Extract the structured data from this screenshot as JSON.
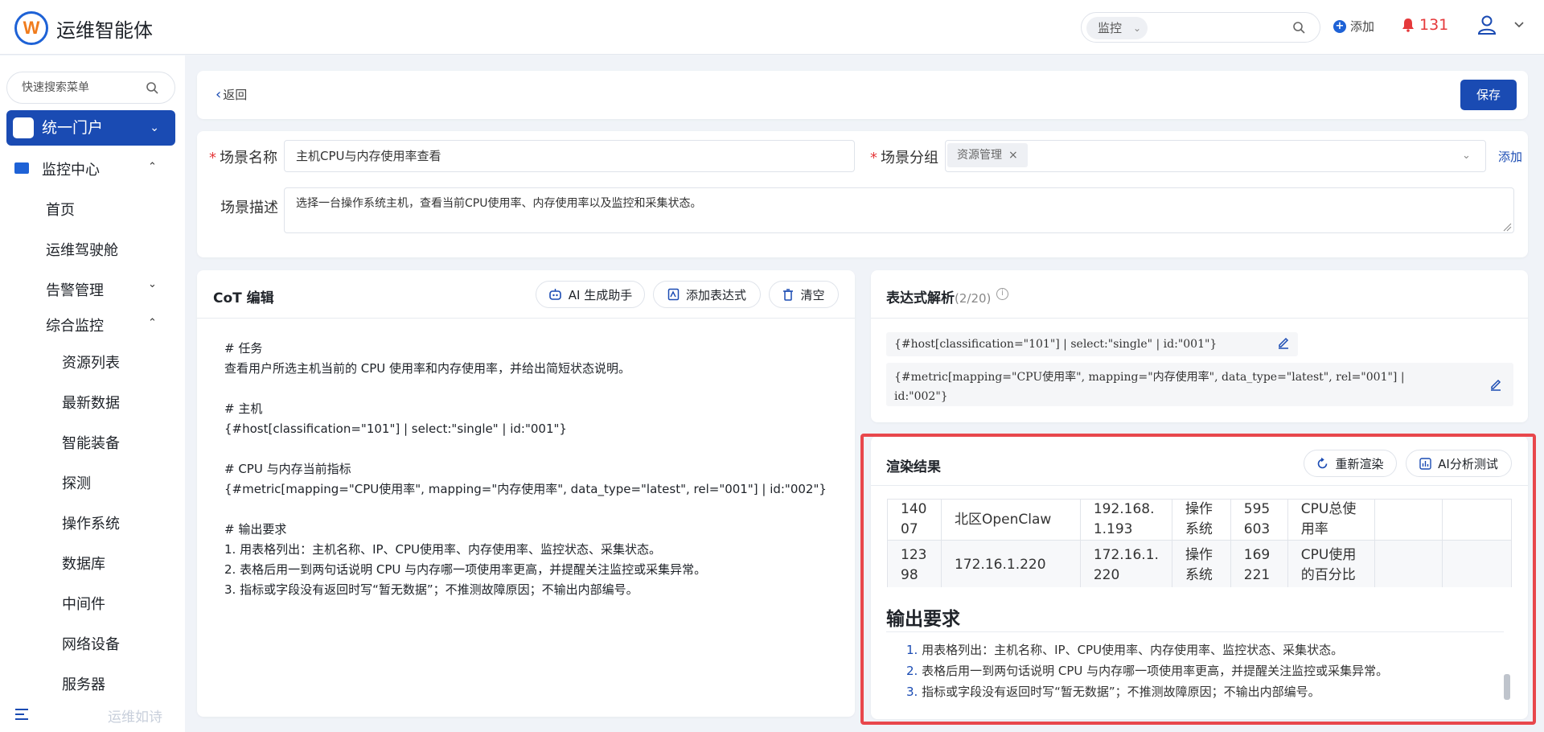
{
  "header": {
    "app_title": "运维智能体",
    "search_category": "监控",
    "add_label": "添加",
    "alert_count": "131"
  },
  "sidebar": {
    "search_placeholder": "快速搜索菜单",
    "portal_label": "统一门户",
    "monitor_center": "监控中心",
    "items": [
      "首页",
      "运维驾驶舱",
      "告警管理",
      "综合监控"
    ],
    "sub_items": [
      "资源列表",
      "最新数据",
      "智能装备",
      "探测",
      "操作系统",
      "数据库",
      "中间件",
      "网络设备",
      "服务器"
    ],
    "footer_text": "运维如诗"
  },
  "toolbar": {
    "back_label": "返回",
    "save_label": "保存"
  },
  "form": {
    "name_label": "场景名称",
    "name_value": "主机CPU与内存使用率查看",
    "group_label": "场景分组",
    "group_tag": "资源管理",
    "group_add": "添加",
    "desc_label": "场景描述",
    "desc_value": "选择一台操作系统主机，查看当前CPU使用率、内存使用率以及监控和采集状态。"
  },
  "cot": {
    "title": "CoT 编辑",
    "ai_button": "AI 生成助手",
    "add_expr_button": "添加表达式",
    "clear_button": "清空",
    "lines": [
      "# 任务",
      "查看用户所选主机当前的 CPU 使用率和内存使用率，并给出简短状态说明。",
      "",
      "# 主机",
      "{#host[classification=\"101\"] | select:\"single\" | id:\"001\"}",
      "",
      "# CPU 与内存当前指标",
      "{#metric[mapping=\"CPU使用率\", mapping=\"内存使用率\", data_type=\"latest\", rel=\"001\"] | id:\"002\"}",
      "",
      "# 输出要求",
      "1. 用表格列出：主机名称、IP、CPU使用率、内存使用率、监控状态、采集状态。",
      "2. 表格后用一到两句话说明 CPU 与内存哪一项使用率更高，并提醒关注监控或采集异常。",
      "3. 指标或字段没有返回时写“暂无数据”；不推测故障原因；不输出内部编号。"
    ]
  },
  "expr": {
    "title": "表达式解析",
    "count": "(2/20)",
    "expr1": "{#host[classification=\"101\"] | select:\"single\" | id:\"001\"}",
    "expr2_line1": "{#metric[mapping=\"CPU使用率\", mapping=\"内存使用率\", data_type=\"latest\", rel=\"001\"] |",
    "expr2_line2": "id:\"002\"}"
  },
  "render": {
    "title": "渲染结果",
    "rerender_button": "重新渲染",
    "ai_test_button": "AI分析测试",
    "rows": [
      {
        "c1a": "140",
        "c1b": "07",
        "c2": "北区OpenClaw",
        "c3a": "192.168.",
        "c3b": "1.193",
        "c4a": "操作",
        "c4b": "系统",
        "c5a": "595",
        "c5b": "603",
        "c6a": "CPU总使",
        "c6b": "用率"
      },
      {
        "c1a": "123",
        "c1b": "98",
        "c2": "172.16.1.220",
        "c3a": "172.16.1.",
        "c3b": "220",
        "c4a": "操作",
        "c4b": "系统",
        "c5a": "169",
        "c5b": "221",
        "c6a": "CPU使用",
        "c6b": "的百分比"
      }
    ],
    "section_title": "输出要求",
    "items": [
      {
        "num": "1.",
        "text": "用表格列出：主机名称、IP、CPU使用率、内存使用率、监控状态、采集状态。"
      },
      {
        "num": "2.",
        "text": "表格后用一到两句话说明 CPU 与内存哪一项使用率更高，并提醒关注监控或采集异常。"
      },
      {
        "num": "3.",
        "text": "指标或字段没有返回时写“暂无数据”；不推测故障原因；不输出内部编号。"
      }
    ]
  },
  "colors": {
    "primary": "#1a4bb3",
    "alert": "#e5393b",
    "highlight_frame": "#e8474c"
  }
}
